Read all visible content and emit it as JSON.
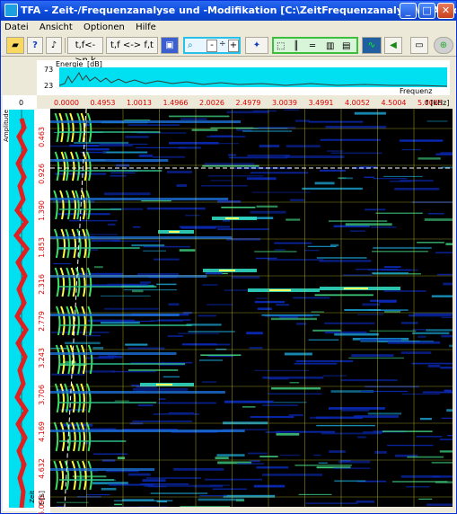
{
  "window": {
    "title": "TFA - Zeit-/Frequenzanalyse und -Modifikation [C:\\ZeitFrequenzanalyse\\TFA\\ind_tfa.wav]",
    "minimize": "_",
    "maximize": "□",
    "close": "✕"
  },
  "menu": [
    "Datei",
    "Ansicht",
    "Optionen",
    "Hilfe"
  ],
  "toolbar": {
    "btn_tf_nk": "t,f<->n,k",
    "btn_tf_ft": "t,f <-> f,t",
    "btn_help": "?",
    "btn_minus": "-",
    "btn_plus": "+"
  },
  "energy": {
    "label": "Energie",
    "unit": "[dB]",
    "ymax": "73",
    "ymin": "23",
    "xlabel": "Frequenz"
  },
  "amplitude": {
    "label": "Amplitude",
    "zero": "0",
    "time_label": "Zeit"
  },
  "freq_axis": {
    "ticks": [
      "0.0000",
      "0.4953",
      "1.0013",
      "1.4966",
      "2.0026",
      "2.4979",
      "3.0039",
      "3.4991",
      "4.0052",
      "4.5004",
      "5.0065"
    ],
    "unit": "f [kHz]"
  },
  "time_axis": {
    "ticks": [
      "0.463",
      "0.926",
      "1.390",
      "1.853",
      "2.316",
      "2.779",
      "3.243",
      "3.706",
      "4.169",
      "4.632",
      "5.096"
    ],
    "unit": "t [s]"
  },
  "colors": {
    "title_bg": "#0a48d8",
    "plot_cyan": "#00e0f0",
    "spec_bg": "#000000",
    "axis_red": "#e00000",
    "grid_yellow": "#c8c832"
  }
}
